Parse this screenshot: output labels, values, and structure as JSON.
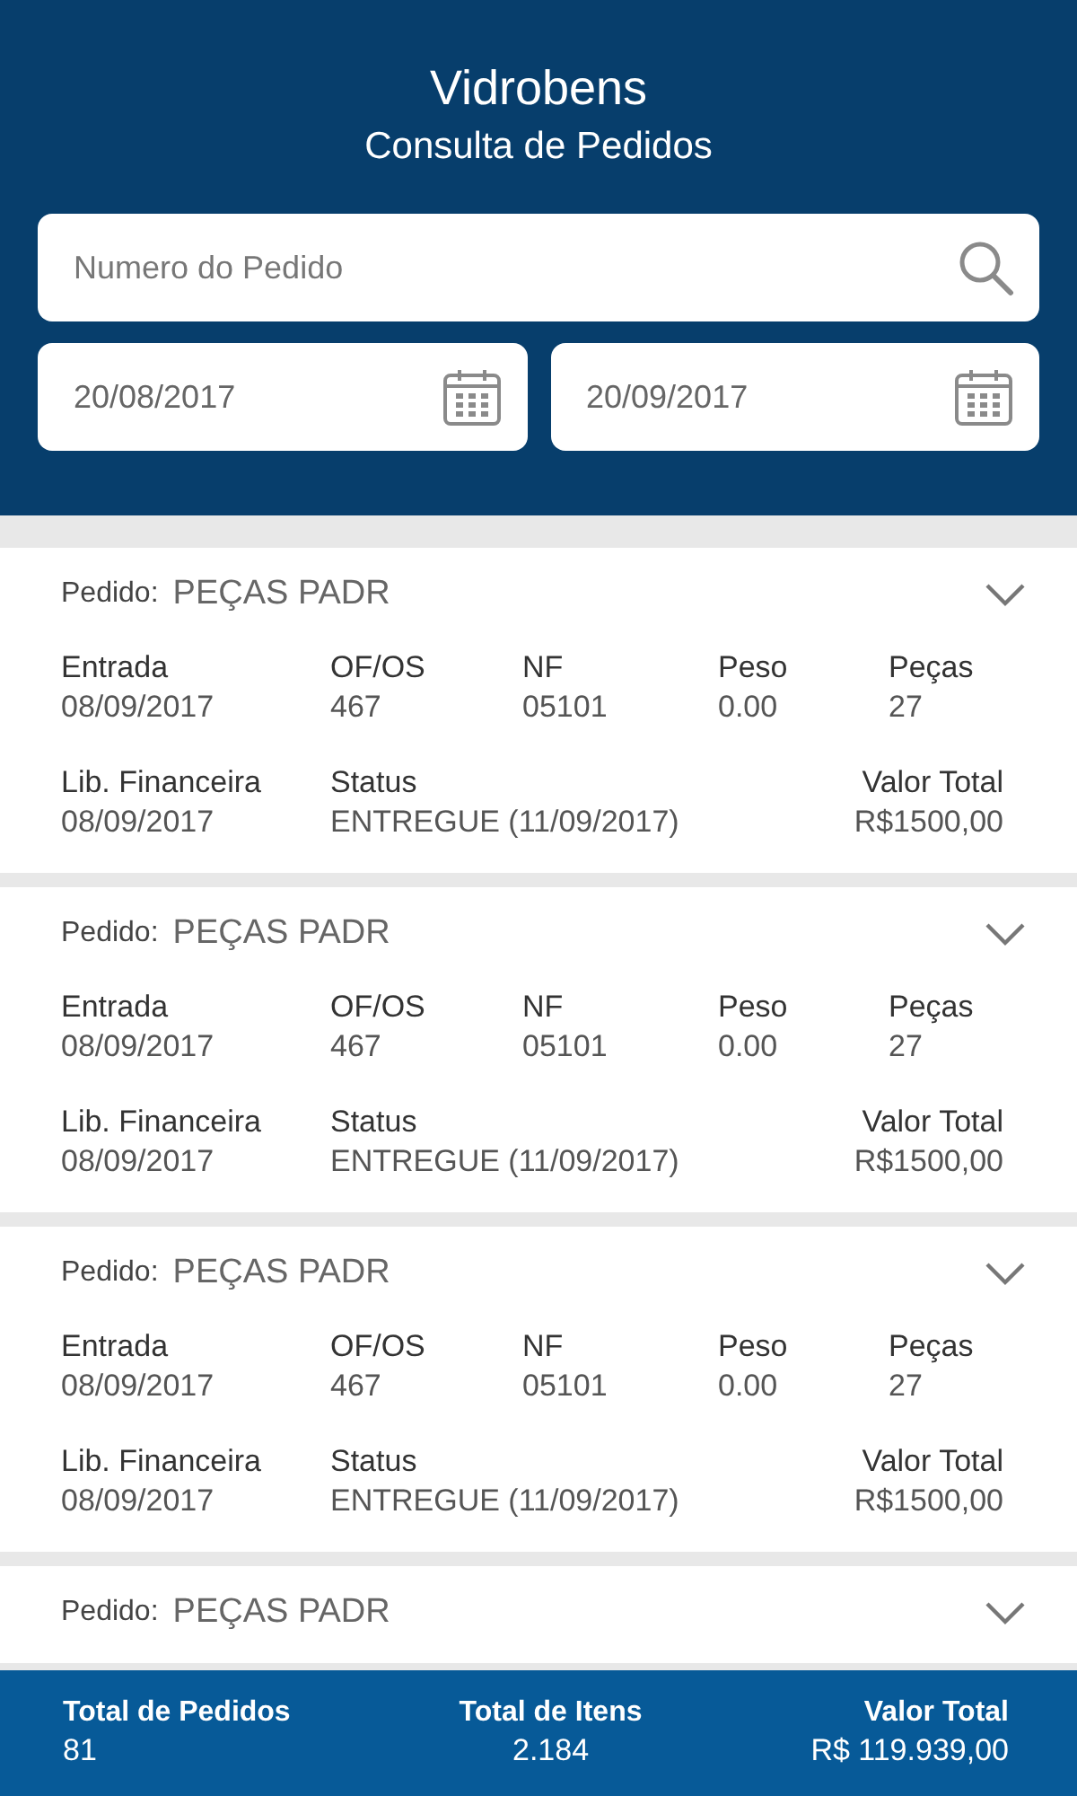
{
  "header": {
    "title": "Vidrobens",
    "subtitle": "Consulta de Pedidos"
  },
  "search": {
    "placeholder": "Numero do Pedido"
  },
  "date_from": {
    "value": "20/08/2017"
  },
  "date_to": {
    "value": "20/09/2017"
  },
  "orders": [
    {
      "pedido_label": "Pedido:",
      "pedido": "PEÇAS PADR",
      "expanded": false,
      "row_1": [
        {
          "label": "Entrada",
          "value": "08/09/2017"
        },
        {
          "label": "OF/OS",
          "value": "467"
        },
        {
          "label": "NF",
          "value": "05101"
        },
        {
          "label": "Peso",
          "value": "0.00"
        },
        {
          "label": "Peças",
          "value": "27"
        }
      ],
      "row_2": [
        {
          "label": "Lib. Financeira",
          "value": "08/09/2017"
        },
        {
          "label": "Status",
          "value": "ENTREGUE (11/09/2017)"
        },
        {
          "label": "Valor Total",
          "value": "R$1500,00"
        }
      ]
    },
    {
      "pedido_label": "Pedido:",
      "pedido": "PEÇAS PADR",
      "expanded": false,
      "row_1": [
        {
          "label": "Entrada",
          "value": "08/09/2017"
        },
        {
          "label": "OF/OS",
          "value": "467"
        },
        {
          "label": "NF",
          "value": "05101"
        },
        {
          "label": "Peso",
          "value": "0.00"
        },
        {
          "label": "Peças",
          "value": "27"
        }
      ],
      "row_2": [
        {
          "label": "Lib. Financeira",
          "value": "08/09/2017"
        },
        {
          "label": "Status",
          "value": "ENTREGUE (11/09/2017)"
        },
        {
          "label": "Valor Total",
          "value": "R$1500,00"
        }
      ]
    },
    {
      "pedido_label": "Pedido:",
      "pedido": "PEÇAS PADR",
      "expanded": false,
      "row_1": [
        {
          "label": "Entrada",
          "value": "08/09/2017"
        },
        {
          "label": "OF/OS",
          "value": "467"
        },
        {
          "label": "NF",
          "value": "05101"
        },
        {
          "label": "Peso",
          "value": "0.00"
        },
        {
          "label": "Peças",
          "value": "27"
        }
      ],
      "row_2": [
        {
          "label": "Lib. Financeira",
          "value": "08/09/2017"
        },
        {
          "label": "Status",
          "value": "ENTREGUE (11/09/2017)"
        },
        {
          "label": "Valor Total",
          "value": "R$1500,00"
        }
      ]
    },
    {
      "pedido_label": "Pedido:",
      "pedido": "PEÇAS PADR",
      "expanded": false
    }
  ],
  "footer": [
    {
      "label": "Total de Pedidos",
      "value": "81"
    },
    {
      "label": "Total de Itens",
      "value": "2.184"
    },
    {
      "label": "Valor Total",
      "value": "R$ 119.939,00"
    }
  ]
}
